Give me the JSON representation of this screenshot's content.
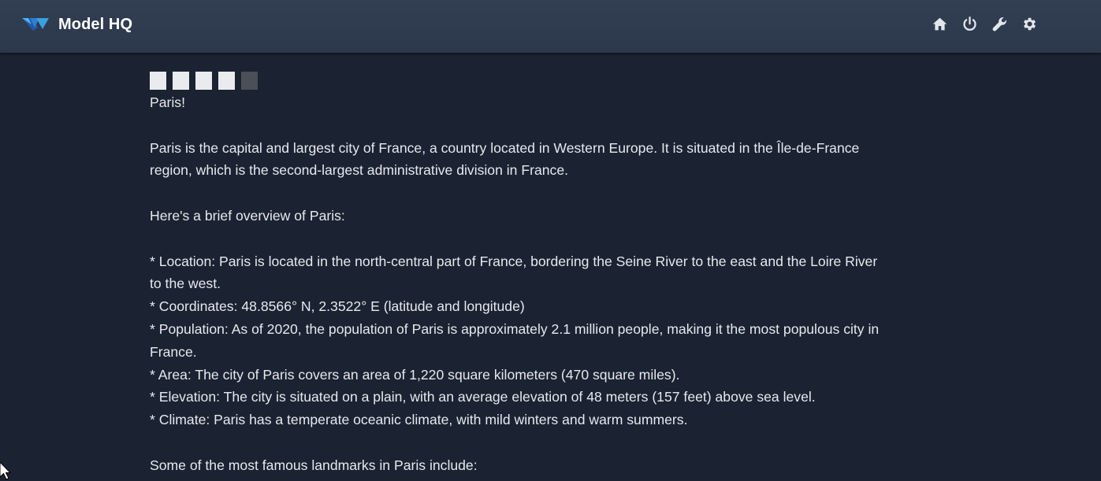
{
  "app": {
    "title": "Model HQ"
  },
  "toolbar": {
    "icons": [
      "home-icon",
      "power-icon",
      "wrench-icon",
      "gear-icon"
    ]
  },
  "colors": {
    "topbar": "#2f3a4e",
    "background": "#1b2332",
    "text": "#e6e9ee",
    "logo_dark": "#1f5aa8",
    "logo_light": "#3aa0e0"
  },
  "response": {
    "greeting": "Paris!",
    "intro_1": "Paris is the capital and largest city of France, a country located in Western Europe. It is situated in the Île-de-France",
    "intro_2": "region, which is the second-largest administrative division in France.",
    "overview_heading": "Here's a brief overview of Paris:",
    "bullets": [
      "* Location: Paris is located in the north-central part of France, bordering the Seine River to the east and the Loire River",
      "to the west.",
      "* Coordinates: 48.8566° N, 2.3522° E (latitude and longitude)",
      "* Population: As of 2020, the population of Paris is approximately 2.1 million people, making it the most populous city in",
      "France.",
      "* Area: The city of Paris covers an area of 1,220 square kilometers (470 square miles).",
      "* Elevation: The city is situated on a plain, with an average elevation of 48 meters (157 feet) above sea level.",
      "* Climate: Paris has a temperate oceanic climate, with mild winters and warm summers."
    ],
    "landmarks_heading": "Some of the most famous landmarks in Paris include:"
  }
}
